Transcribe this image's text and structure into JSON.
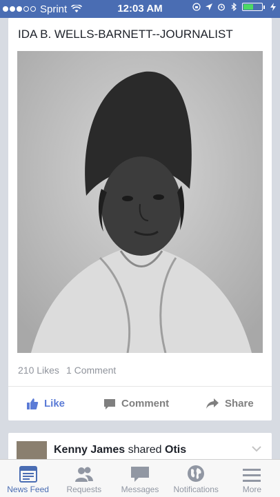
{
  "status_bar": {
    "carrier": "Sprint",
    "time": "12:03 AM",
    "battery_level": 0.55,
    "accent_color": "#4a6db3"
  },
  "post": {
    "title": "IDA B. WELLS-BARNETT--JOURNALIST",
    "likes": "210 Likes",
    "comments": "1 Comment",
    "actions": {
      "like": "Like",
      "comment": "Comment",
      "share": "Share"
    }
  },
  "next_post": {
    "author": "Kenny James",
    "verb": "shared",
    "target": "Otis"
  },
  "tabs": [
    {
      "label": "News Feed",
      "icon": "news-feed-icon",
      "active": true
    },
    {
      "label": "Requests",
      "icon": "requests-icon",
      "active": false
    },
    {
      "label": "Messages",
      "icon": "messages-icon",
      "active": false
    },
    {
      "label": "Notifications",
      "icon": "globe-icon",
      "active": false
    },
    {
      "label": "More",
      "icon": "menu-icon",
      "active": false
    }
  ]
}
